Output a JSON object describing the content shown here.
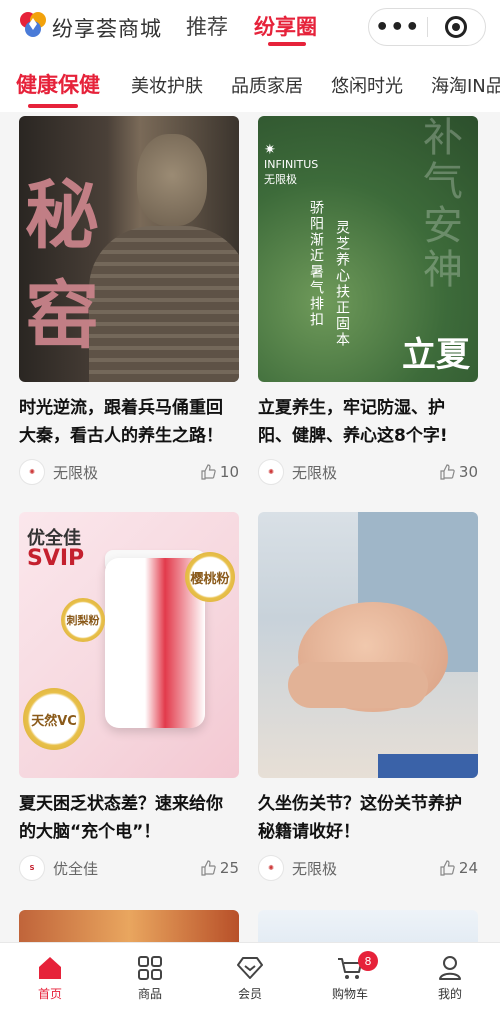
{
  "header": {
    "brand_name": "纷享荟商城",
    "nav": [
      {
        "label": "推荐"
      },
      {
        "label": "纷享圈"
      }
    ],
    "capsule": {
      "more_icon": "more-dots-icon",
      "close_icon": "target-icon"
    }
  },
  "categories": [
    {
      "label": "健康保健",
      "active": true
    },
    {
      "label": "美妆护肤"
    },
    {
      "label": "品质家居"
    },
    {
      "label": "悠闲时光"
    },
    {
      "label": "海淘IN品"
    }
  ],
  "feed": [
    {
      "title": "时光逆流，跟着兵马俑重回大秦，看古人的养生之路！",
      "author": "无限极",
      "likes": "10",
      "image_text": {
        "big": [
          "秘",
          "窑"
        ]
      }
    },
    {
      "title": "立夏养生，牢记防湿、护阳、健脾、养心这8个字!",
      "author": "无限极",
      "likes": "30",
      "image_text": {
        "brand_en": "INFINITUS",
        "brand_cn": "无限极",
        "col1": "骄阳渐近暑气排扣",
        "col2": "灵芝养心扶正固本",
        "big": "补气安神",
        "season": "立夏"
      }
    },
    {
      "title": "夏天困乏状态差？速来给你的大脑“充个电”！",
      "author": "优全佳",
      "likes": "25",
      "image_text": {
        "brand1": "优全佳",
        "brand2": "SVIP",
        "badge1": "樱桃粉",
        "badge2": "刺梨粉",
        "badge3": "天然VC"
      }
    },
    {
      "title": "久坐伤关节？这份关节养护秘籍请收好！",
      "author": "无限极",
      "likes": "24"
    }
  ],
  "tabbar": [
    {
      "label": "首页",
      "icon": "home-icon",
      "active": true
    },
    {
      "label": "商品",
      "icon": "grid-icon"
    },
    {
      "label": "会员",
      "icon": "diamond-icon"
    },
    {
      "label": "购物车",
      "icon": "cart-icon",
      "badge": "8"
    },
    {
      "label": "我的",
      "icon": "user-icon"
    }
  ],
  "colors": {
    "accent": "#e6223a"
  }
}
